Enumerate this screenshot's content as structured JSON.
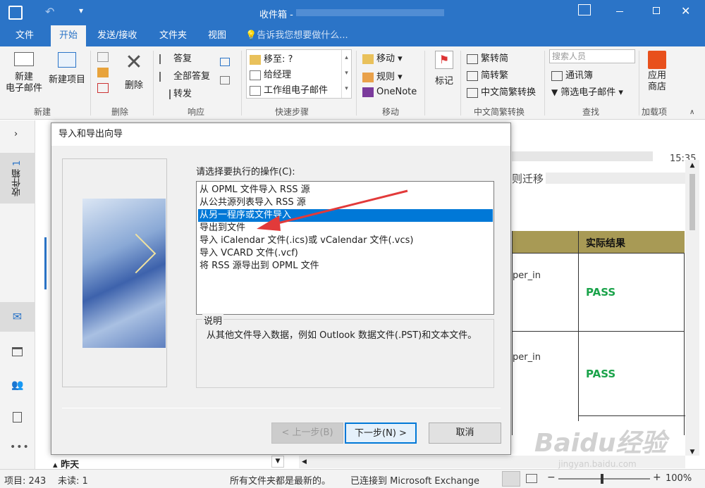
{
  "window": {
    "title": "收件箱 - "
  },
  "tabs": [
    "文件",
    "开始",
    "发送/接收",
    "文件夹",
    "视图"
  ],
  "tell_me": "告诉我您想要做什么...",
  "ribbon": {
    "new_email": "新建\n电子邮件",
    "new_items": "新建项目",
    "group_new": "新建",
    "delete": "删除",
    "group_delete": "删除",
    "reply": "答复",
    "reply_all": "全部答复",
    "forward": "转发",
    "group_respond": "响应",
    "quick_steps": [
      "移至: ?",
      "给经理",
      "工作组电子邮件"
    ],
    "group_quick_steps": "快速步骤",
    "move": "移动",
    "rules": "规则",
    "onenote": "OneNote",
    "group_move": "移动",
    "tags": "标记",
    "trad": "繁转简",
    "simp": "简转繁",
    "convert": "中文简繁转换",
    "group_convert": "中文简繁转换",
    "search_people": "搜索人员",
    "address_book": "通讯簿",
    "filter_email": "筛选电子邮件",
    "group_find": "查找",
    "store": "应用\n商店",
    "group_addins": "加载项"
  },
  "left_nav": {
    "inbox_label": "收件箱",
    "inbox_count": "1"
  },
  "mail": {
    "time": "15:35",
    "subject_frag": "则迁移",
    "table_header": "实际结果",
    "row_frag": "per_in",
    "pass1": "PASS",
    "pass2": "PASS",
    "date_group": "昨天"
  },
  "dialog": {
    "title": "导入和导出向导",
    "prompt": "请选择要执行的操作(C):",
    "options": [
      "从 OPML 文件导入 RSS 源",
      "从公共源列表导入 RSS 源",
      "从另一程序或文件导入",
      "导出到文件",
      "导入 iCalendar 文件(.ics)或 vCalendar 文件(.vcs)",
      "导入 VCARD 文件(.vcf)",
      "将 RSS 源导出到 OPML 文件"
    ],
    "selected_index": 2,
    "desc_label": "说明",
    "desc_text": "从其他文件导入数据，例如 Outlook 数据文件(.PST)和文本文件。",
    "back": "< 上一步(B)",
    "next": "下一步(N) >",
    "cancel": "取消"
  },
  "status": {
    "items": "项目: 243",
    "unread": "未读: 1",
    "sync": "所有文件夹都是最新的。",
    "connected": "已连接到 Microsoft Exchange",
    "zoom": "100%"
  },
  "watermark": "Baidu经验",
  "watermark_url": "jingyan.baidu.com"
}
